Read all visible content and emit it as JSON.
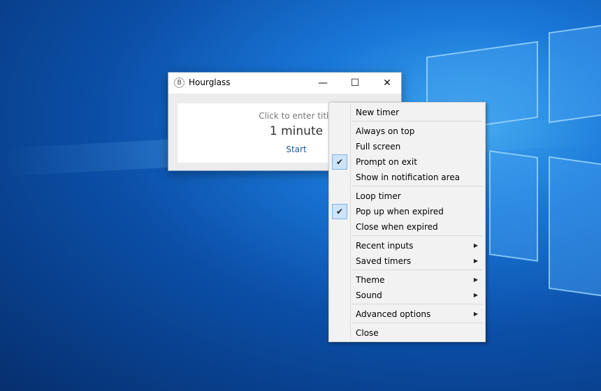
{
  "window": {
    "title": "Hourglass",
    "icon": "hourglass-8-icon",
    "minimize": "—",
    "maximize": "☐",
    "close": "✕"
  },
  "timer": {
    "title_placeholder": "Click to enter title",
    "duration": "1 minute",
    "start": "Start"
  },
  "menu": {
    "items": [
      {
        "label": "New timer",
        "checked": false,
        "submenu": false
      },
      {
        "label": "Always on top",
        "checked": false,
        "submenu": false
      },
      {
        "label": "Full screen",
        "checked": false,
        "submenu": false
      },
      {
        "label": "Prompt on exit",
        "checked": true,
        "submenu": false
      },
      {
        "label": "Show in notification area",
        "checked": false,
        "submenu": false
      },
      {
        "label": "Loop timer",
        "checked": false,
        "submenu": false
      },
      {
        "label": "Pop up when expired",
        "checked": true,
        "submenu": false
      },
      {
        "label": "Close when expired",
        "checked": false,
        "submenu": false
      },
      {
        "label": "Recent inputs",
        "checked": false,
        "submenu": true
      },
      {
        "label": "Saved timers",
        "checked": false,
        "submenu": true
      },
      {
        "label": "Theme",
        "checked": false,
        "submenu": true
      },
      {
        "label": "Sound",
        "checked": false,
        "submenu": true
      },
      {
        "label": "Advanced options",
        "checked": false,
        "submenu": true
      },
      {
        "label": "Close",
        "checked": false,
        "submenu": false
      }
    ],
    "check_glyph": "✔",
    "arrow_glyph": "▶"
  }
}
